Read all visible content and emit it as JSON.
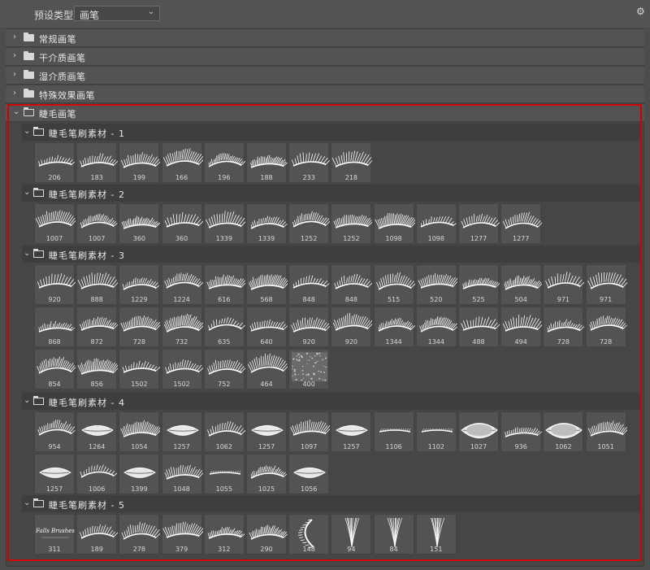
{
  "toolbar": {
    "preset_label": "预设类型:",
    "preset_value": "画笔",
    "chevron": "⌄",
    "gear": "⚙"
  },
  "groups": [
    {
      "label": "常规画笔",
      "expanded": false
    },
    {
      "label": "干介质画笔",
      "expanded": false
    },
    {
      "label": "湿介质画笔",
      "expanded": false
    },
    {
      "label": "特殊效果画笔",
      "expanded": false
    },
    {
      "label": "睫毛画笔",
      "expanded": true
    }
  ],
  "subgroups": [
    {
      "label": "睫毛笔刷素材 - 1",
      "tiles": [
        "206",
        "183",
        "199",
        "166",
        "196",
        "188",
        "233",
        "218"
      ]
    },
    {
      "label": "睫毛笔刷素材 - 2",
      "tiles": [
        "1007",
        "1007",
        "360",
        "360",
        "1339",
        "1339",
        "1252",
        "1252",
        "1098",
        "1098",
        "1277",
        "1277"
      ]
    },
    {
      "label": "睫毛笔刷素材 - 3",
      "tiles": [
        "920",
        "888",
        "1229",
        "1224",
        "616",
        "568",
        "848",
        "848",
        "515",
        "520",
        "525",
        "504",
        "971",
        "971",
        "868",
        "872",
        "728",
        "732",
        "635",
        "640",
        "920",
        "920",
        "1344",
        "1344",
        "488",
        "494",
        "728",
        "728",
        "854",
        "856",
        "1502",
        "1502",
        "752",
        "464",
        "400"
      ]
    },
    {
      "label": "睫毛笔刷素材 - 4",
      "tiles": [
        "954",
        "1264",
        "1054",
        "1257",
        "1062",
        "1257",
        "1097",
        "1257",
        "1106",
        "1102",
        "1027",
        "936",
        "1062",
        "1051",
        "1257",
        "1006",
        "1399",
        "1048",
        "1055",
        "1025",
        "1056"
      ]
    },
    {
      "label": "睫毛笔刷素材 - 5",
      "tiles": [
        "311",
        "189",
        "278",
        "379",
        "312",
        "290",
        "148",
        "94",
        "84",
        "151"
      ]
    }
  ],
  "tile_kinds": {
    "睫毛笔刷素材 - 4": [
      "lash",
      "lips",
      "lash",
      "lips",
      "lash",
      "lips",
      "lash",
      "lips",
      "line",
      "line",
      "lipsbig",
      "lash",
      "lipsbig",
      "lash",
      "lips",
      "lash",
      "lips",
      "lash",
      "line",
      "lash",
      "lips"
    ],
    "睫毛笔刷素材 - 5": [
      "text",
      "lash",
      "lash",
      "lash",
      "lash",
      "lash",
      "curve",
      "fan",
      "fan",
      "fan"
    ]
  },
  "tile5_text": "Falls Brushes",
  "colors": {
    "highlight": "#d40000",
    "tile_bg": "#535353",
    "stroke": "#ffffff"
  },
  "icons": {
    "collapsed": "chevron-right-icon",
    "expanded": "chevron-down-icon",
    "folder": "folder-icon",
    "settings": "gear-icon"
  }
}
